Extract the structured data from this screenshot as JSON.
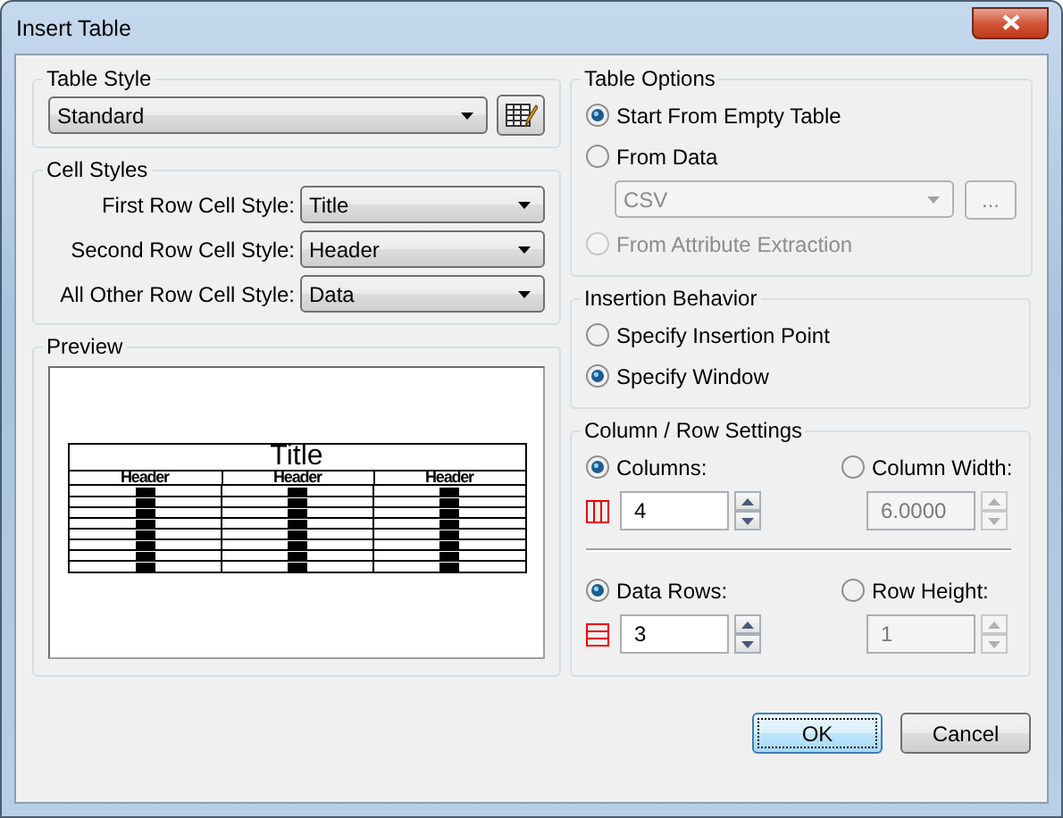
{
  "window": {
    "title": "Insert Table"
  },
  "table_style": {
    "label": "Table Style",
    "value": "Standard"
  },
  "cell_styles": {
    "label": "Cell Styles",
    "rows": [
      {
        "label": "First Row Cell Style:",
        "value": "Title"
      },
      {
        "label": "Second Row Cell Style:",
        "value": "Header"
      },
      {
        "label": "All Other Row Cell Style:",
        "value": "Data"
      }
    ]
  },
  "preview": {
    "label": "Preview",
    "title": "Title",
    "headers": [
      "Header",
      "Header",
      "Header"
    ]
  },
  "table_options": {
    "label": "Table Options",
    "options": [
      {
        "label": "Start From Empty Table",
        "selected": true,
        "disabled": false
      },
      {
        "label": "From Data",
        "selected": false,
        "disabled": false
      },
      {
        "label": "From Attribute Extraction",
        "selected": false,
        "disabled": true
      }
    ],
    "data_source": {
      "value": "CSV",
      "disabled": true
    },
    "browse_label": "..."
  },
  "insertion_behavior": {
    "label": "Insertion Behavior",
    "options": [
      {
        "label": "Specify Insertion Point",
        "selected": false
      },
      {
        "label": "Specify Window",
        "selected": true
      }
    ]
  },
  "column_row_settings": {
    "label": "Column / Row Settings",
    "rows": [
      {
        "kind": "columns",
        "count": {
          "label": "Columns:",
          "selected": true,
          "value": "4"
        },
        "size": {
          "label": "Column Width:",
          "selected": false,
          "value": "6.0000"
        }
      },
      {
        "kind": "rows",
        "count": {
          "label": "Data Rows:",
          "selected": true,
          "value": "3"
        },
        "size": {
          "label": "Row Height:",
          "selected": false,
          "value": "1"
        }
      }
    ]
  },
  "buttons": [
    {
      "label": "OK",
      "default": true
    },
    {
      "label": "Cancel",
      "default": false
    }
  ]
}
